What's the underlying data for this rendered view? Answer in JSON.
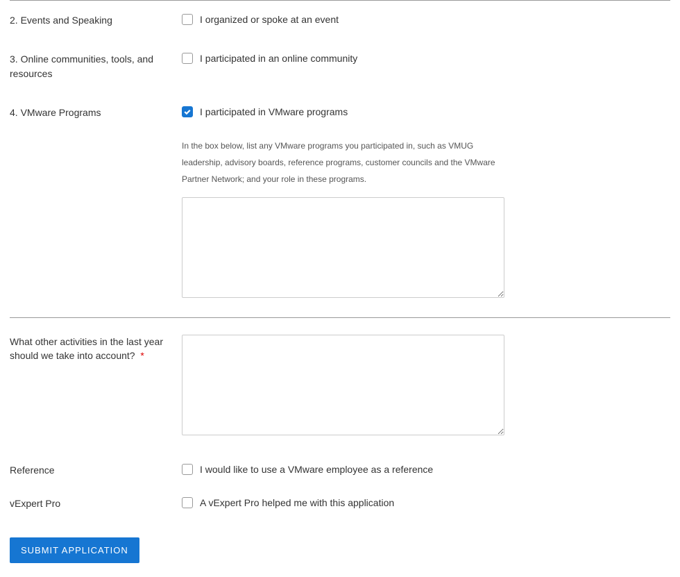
{
  "rows": {
    "events": {
      "label": "2. Events and Speaking",
      "checkbox_label": "I organized or spoke at an event",
      "checked": false
    },
    "online": {
      "label": "3. Online communities, tools, and resources",
      "checkbox_label": "I participated in an online community",
      "checked": false
    },
    "vmware": {
      "label": "4. VMware Programs",
      "checkbox_label": "I participated in VMware programs",
      "checked": true,
      "help_text": "In the box below, list any VMware programs you participated in, such as VMUG leadership, advisory boards, reference programs, customer councils and the VMware Partner Network; and your role in these programs.",
      "textarea_value": ""
    },
    "other": {
      "label": "What other activities in the last year should we take into account?",
      "required_marker": "*",
      "textarea_value": ""
    },
    "reference": {
      "label": "Reference",
      "checkbox_label": "I would like to use a VMware employee as a reference",
      "checked": false
    },
    "vexpert": {
      "label": "vExpert Pro",
      "checkbox_label": "A vExpert Pro helped me with this application",
      "checked": false
    }
  },
  "submit_label": "SUBMIT APPLICATION"
}
